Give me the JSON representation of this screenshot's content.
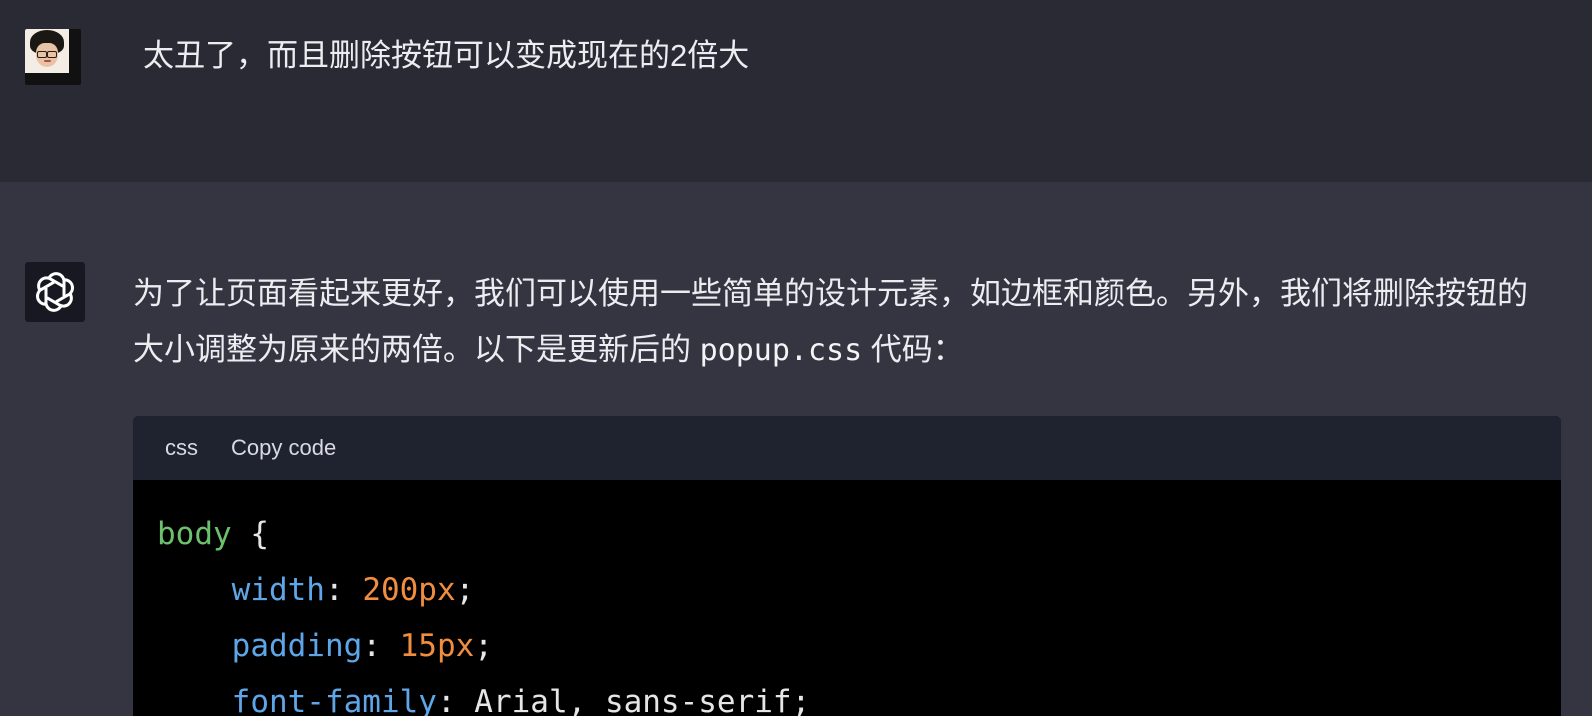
{
  "user_message": {
    "text": "太丑了，而且删除按钮可以变成现在的2倍大"
  },
  "assistant_message": {
    "text_before_code": "为了让页面看起来更好，我们可以使用一些简单的设计元素，如边框和颜色。另外，我们将删除按钮的大小调整为原来的两倍。以下是更新后的 ",
    "inline_code": "popup.css",
    "text_after_code": " 代码："
  },
  "code_block": {
    "language": "css",
    "copy_label": "Copy code",
    "lines": [
      {
        "selector": "body",
        "punc": " {"
      },
      {
        "indent": "    ",
        "property": "width",
        "sep": ": ",
        "value": "200px",
        "end": ";"
      },
      {
        "indent": "    ",
        "property": "padding",
        "sep": ": ",
        "value": "15px",
        "end": ";"
      },
      {
        "indent": "    ",
        "property": "font-family",
        "sep": ": ",
        "value": "Arial, sans-serif",
        "end": ";"
      }
    ]
  },
  "colors": {
    "user_row_bg": "#292a33",
    "assistant_row_bg": "#343541",
    "code_header_bg": "#1f2330",
    "code_bg": "#000000",
    "selector": "#6ec16c",
    "property": "#5ea6e8",
    "number": "#f08d3f"
  }
}
